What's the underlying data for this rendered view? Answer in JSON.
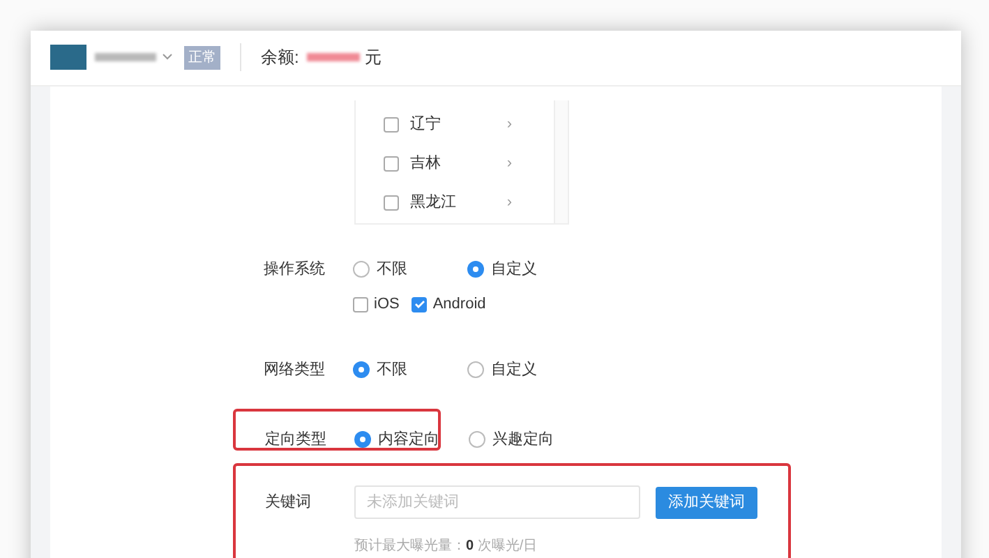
{
  "header": {
    "status_badge": "正常",
    "balance_label": "余额:",
    "balance_unit": "元"
  },
  "regions": [
    {
      "label": "辽宁",
      "checked": false,
      "arrow": "›"
    },
    {
      "label": "吉林",
      "checked": false,
      "arrow": "›"
    },
    {
      "label": "黑龙江",
      "checked": false,
      "arrow": "›"
    }
  ],
  "os": {
    "label": "操作系统",
    "options": [
      {
        "label": "不限",
        "selected": false
      },
      {
        "label": "自定义",
        "selected": true
      }
    ],
    "platforms": [
      {
        "label": "iOS",
        "checked": false
      },
      {
        "label": "Android",
        "checked": true
      }
    ]
  },
  "network": {
    "label": "网络类型",
    "options": [
      {
        "label": "不限",
        "selected": true
      },
      {
        "label": "自定义",
        "selected": false
      }
    ]
  },
  "targeting": {
    "label": "定向类型",
    "highlighted": true,
    "options": [
      {
        "label": "内容定向",
        "selected": true
      },
      {
        "label": "兴趣定向",
        "selected": false
      }
    ]
  },
  "keywords": {
    "label": "关键词",
    "highlighted": true,
    "placeholder": "未添加关键词",
    "button": "添加关键词",
    "estimate": "预计最大曝光量：**0** 次曝光/日"
  }
}
